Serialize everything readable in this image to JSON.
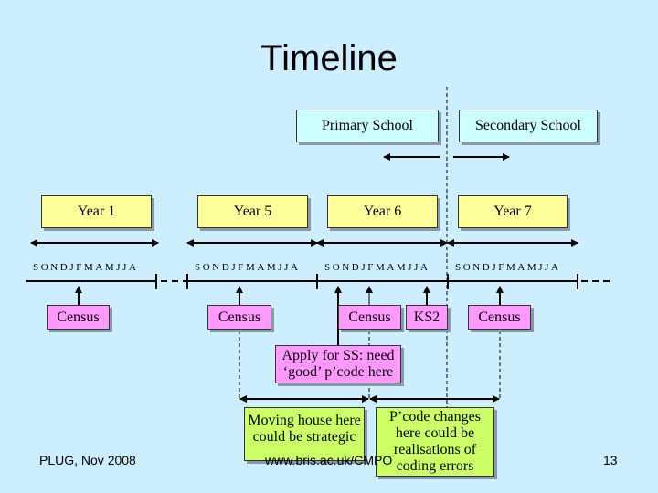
{
  "slide": {
    "title": "Timeline",
    "footer_left": "PLUG, Nov 2008",
    "footer_center": "www.bris.ac.uk/CMPO",
    "page_number": "13",
    "colors": {
      "background": "#cceeff",
      "school_box": "#ccffff",
      "year_box": "#ffff99",
      "event_box": "#ff99ff",
      "note_box": "#ccff66"
    }
  },
  "schools": [
    {
      "label": "Primary School"
    },
    {
      "label": "Secondary School"
    }
  ],
  "years": [
    {
      "label": "Year 1",
      "months": "SONDJFMAMJJA"
    },
    {
      "label": "Year 5",
      "months": "SONDJFMAMJJA"
    },
    {
      "label": "Year 6",
      "months": "SONDJFMAMJJA"
    },
    {
      "label": "Year 7",
      "months": "SONDJFMAMJJA"
    }
  ],
  "events": [
    {
      "label": "Census"
    },
    {
      "label": "Census"
    },
    {
      "label": "Census"
    },
    {
      "label": "KS2"
    },
    {
      "label": "Census"
    }
  ],
  "apply": {
    "line1": "Apply for SS: need",
    "line2": "‘good’ p’code here"
  },
  "notes": {
    "moving": {
      "line1": "Moving house here",
      "line2": "could be strategic"
    },
    "pcode": {
      "line1": "P’code changes",
      "line2": "here could be",
      "line3": "realisations of",
      "line4": "coding errors"
    }
  }
}
